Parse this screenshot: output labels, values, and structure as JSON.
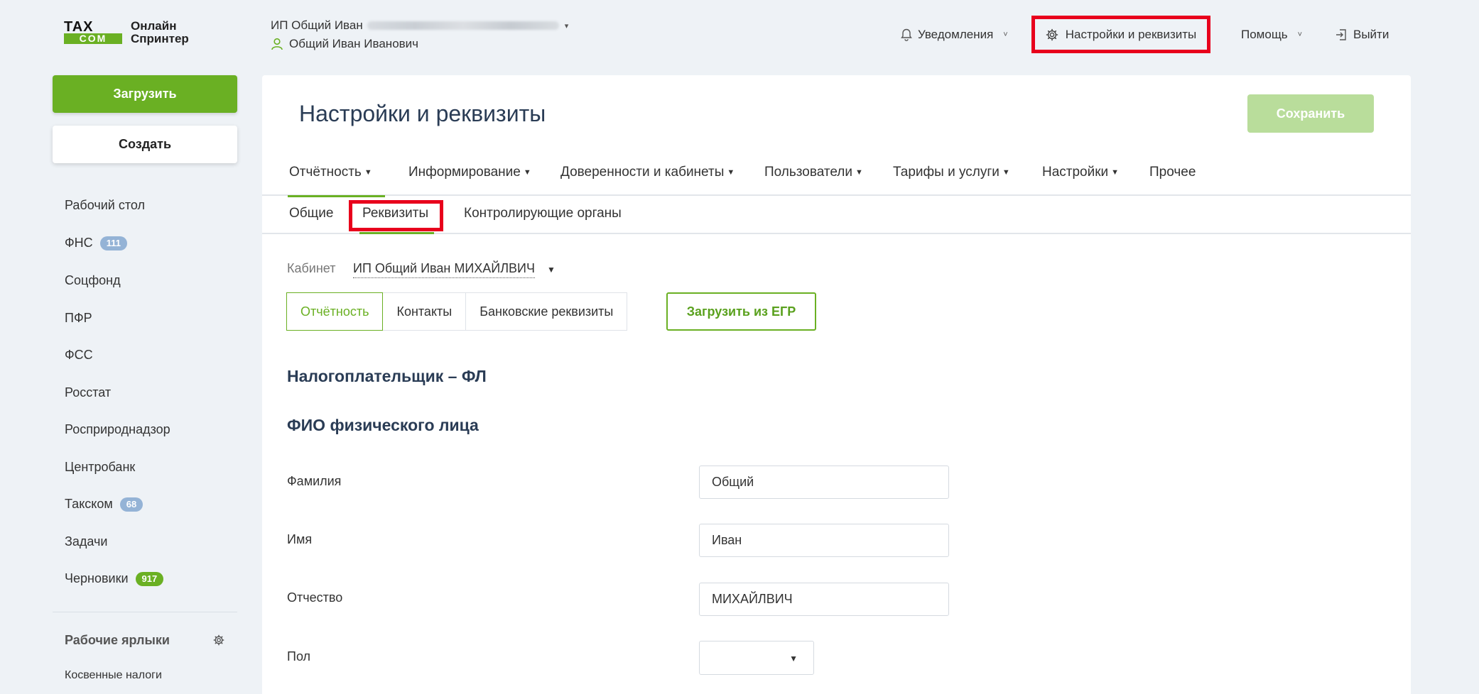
{
  "header": {
    "logo_top": "TAX",
    "logo_bottom": "COM",
    "logo_line1": "Онлайн",
    "logo_line2": "Спринтер",
    "org_name": "ИП Общий Иван",
    "user_name": "Общий Иван Иванович",
    "notifications_label": "Уведомления",
    "settings_label": "Настройки и реквизиты",
    "help_label": "Помощь",
    "logout_label": "Выйти"
  },
  "sidebar": {
    "upload_label": "Загрузить",
    "create_label": "Создать",
    "items": [
      {
        "label": "Рабочий стол",
        "badge": ""
      },
      {
        "label": "ФНС",
        "badge": "111"
      },
      {
        "label": "Соцфонд",
        "badge": ""
      },
      {
        "label": "ПФР",
        "badge": ""
      },
      {
        "label": "ФСС",
        "badge": ""
      },
      {
        "label": "Росстат",
        "badge": ""
      },
      {
        "label": "Росприроднадзор",
        "badge": ""
      },
      {
        "label": "Центробанк",
        "badge": ""
      },
      {
        "label": "Такском",
        "badge": "68"
      },
      {
        "label": "Задачи",
        "badge": ""
      },
      {
        "label": "Черновики",
        "badge": "917"
      }
    ],
    "shortcuts_title": "Рабочие ярлыки",
    "shortcut_item": "Косвенные налоги"
  },
  "main": {
    "title": "Настройки и реквизиты",
    "save_label": "Сохранить",
    "tabs": [
      {
        "label": "Отчётность"
      },
      {
        "label": "Информирование"
      },
      {
        "label": "Доверенности и кабинеты"
      },
      {
        "label": "Пользователи"
      },
      {
        "label": "Тарифы и услуги"
      },
      {
        "label": "Настройки"
      },
      {
        "label": "Прочее"
      }
    ],
    "subtabs": [
      {
        "label": "Общие"
      },
      {
        "label": "Реквизиты"
      },
      {
        "label": "Контролирующие органы"
      }
    ],
    "cabinet_label": "Кабинет",
    "cabinet_value": "ИП Общий Иван МИХАЙЛВИЧ",
    "segments": [
      {
        "label": "Отчётность"
      },
      {
        "label": "Контакты"
      },
      {
        "label": "Банковские реквизиты"
      }
    ],
    "egr_button": "Загрузить из ЕГР",
    "section1": "Налогоплательщик – ФЛ",
    "section2": "ФИО физического лица",
    "fields": {
      "surname_label": "Фамилия",
      "surname_value": "Общий",
      "name_label": "Имя",
      "name_value": "Иван",
      "patronymic_label": "Отчество",
      "patronymic_value": "МИХАЙЛВИЧ",
      "gender_label": "Пол",
      "gender_value": ""
    }
  },
  "colors": {
    "accent_green": "#6ab023",
    "highlight_red": "#e8001c",
    "badge_blue": "#94b3d6",
    "title_navy": "#2a3c55"
  }
}
